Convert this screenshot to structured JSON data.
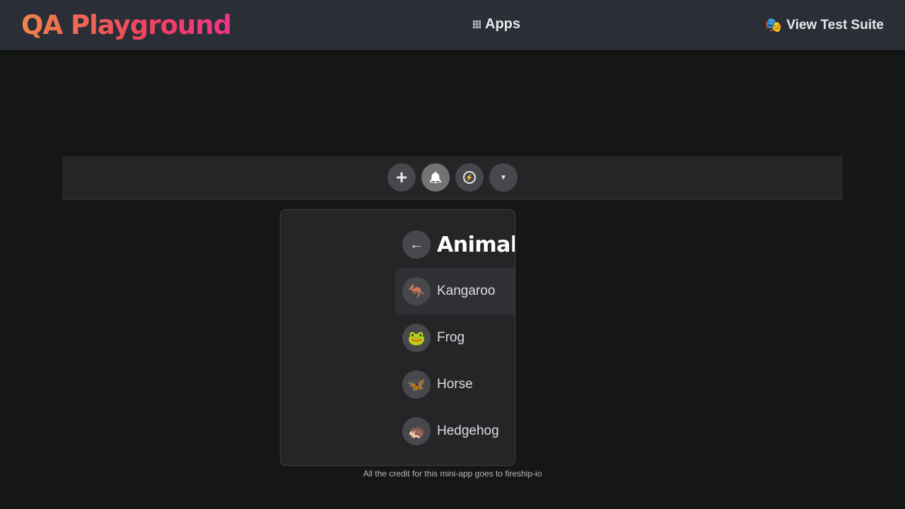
{
  "header": {
    "logo": "QA Playground",
    "apps_label": "Apps",
    "apps_icon": "grid-icon",
    "suite_label": "View Test Suite",
    "suite_icon": "performing-arts-mask-icon"
  },
  "navbar": {
    "buttons": [
      {
        "icon": "plus-icon",
        "glyph": "+"
      },
      {
        "icon": "bell-icon",
        "glyph": "🔔"
      },
      {
        "icon": "messenger-icon",
        "glyph": "⚡"
      },
      {
        "icon": "caret-down-icon",
        "glyph": "▼"
      }
    ]
  },
  "menu": {
    "back_glyph": "←",
    "title": "Animals",
    "items": [
      {
        "label": "Kangaroo",
        "emoji": "🦘",
        "highlighted": true
      },
      {
        "label": "Frog",
        "emoji": "🐸"
      },
      {
        "label": "Horse",
        "emoji": "🦋"
      },
      {
        "label": "Hedgehog",
        "emoji": "🦔"
      }
    ]
  },
  "footer": {
    "credit": "All the credit for this mini-app goes to fireship-io"
  }
}
